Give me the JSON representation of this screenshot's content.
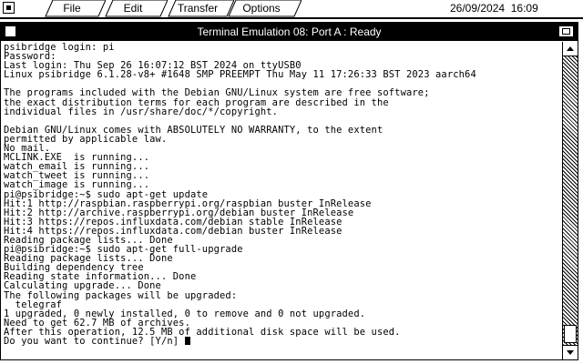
{
  "menubar": {
    "items": [
      "File",
      "Edit",
      "Transfer",
      "Options"
    ],
    "date": "26/09/2024",
    "time": "16:09"
  },
  "window": {
    "title": "Terminal Emulation 08: Port A : Ready"
  },
  "terminal": {
    "lines": [
      "psibridge login: pi",
      "Password:",
      "Last login: Thu Sep 26 16:07:12 BST 2024 on ttyUSB0",
      "Linux psibridge 6.1.28-v8+ #1648 SMP PREEMPT Thu May 11 17:26:33 BST 2023 aarch64",
      "",
      "The programs included with the Debian GNU/Linux system are free software;",
      "the exact distribution terms for each program are described in the",
      "individual files in /usr/share/doc/*/copyright.",
      "",
      "Debian GNU/Linux comes with ABSOLUTELY NO WARRANTY, to the extent",
      "permitted by applicable law.",
      "No mail.",
      "MCLINK.EXE  is running...",
      "watch_email is running...",
      "watch_tweet is running...",
      "watch_image is running...",
      "pi@psibridge:~$ sudo apt-get update",
      "Hit:1 http://raspbian.raspberrypi.org/raspbian buster InRelease",
      "Hit:2 http://archive.raspberrypi.org/debian buster InRelease",
      "Hit:3 https://repos.influxdata.com/debian stable InRelease",
      "Hit:4 https://repos.influxdata.com/debian buster InRelease",
      "Reading package lists... Done",
      "pi@psibridge:~$ sudo apt-get full-upgrade",
      "Reading package lists... Done",
      "Building dependency tree",
      "Reading state information... Done",
      "Calculating upgrade... Done",
      "The following packages will be upgraded:",
      "  telegraf",
      "1 upgraded, 0 newly installed, 0 to remove and 0 not upgraded.",
      "Need to get 62.7 MB of archives.",
      "After this operation, 12.5 MB of additional disk space will be used.",
      "Do you want to continue? [Y/n] "
    ]
  }
}
